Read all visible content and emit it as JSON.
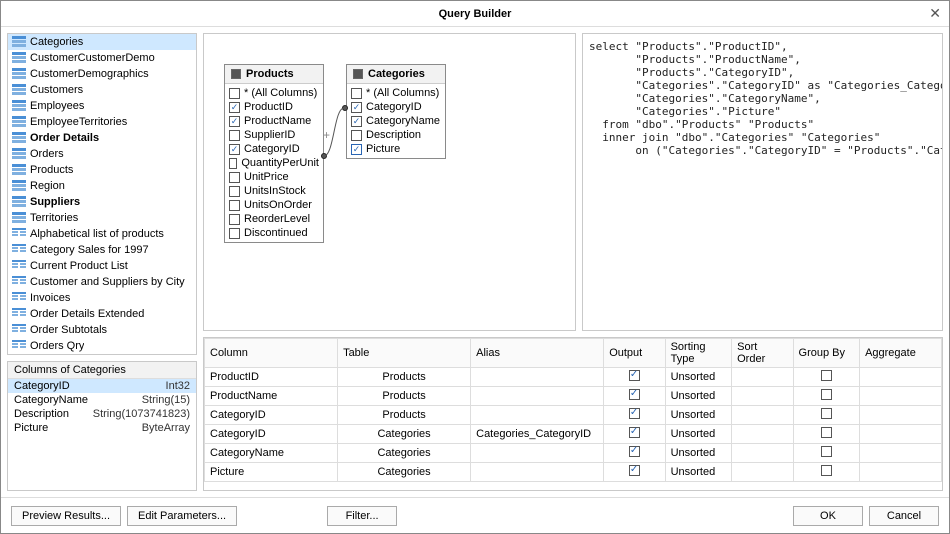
{
  "window": {
    "title": "Query Builder"
  },
  "tables": [
    {
      "name": "Categories",
      "icon": "table",
      "selected": true
    },
    {
      "name": "CustomerCustomerDemo",
      "icon": "table"
    },
    {
      "name": "CustomerDemographics",
      "icon": "table"
    },
    {
      "name": "Customers",
      "icon": "table"
    },
    {
      "name": "Employees",
      "icon": "table"
    },
    {
      "name": "EmployeeTerritories",
      "icon": "table"
    },
    {
      "name": "Order Details",
      "icon": "table",
      "bold": true
    },
    {
      "name": "Orders",
      "icon": "table"
    },
    {
      "name": "Products",
      "icon": "table"
    },
    {
      "name": "Region",
      "icon": "table"
    },
    {
      "name": "Suppliers",
      "icon": "table",
      "bold": true
    },
    {
      "name": "Territories",
      "icon": "table"
    },
    {
      "name": "Alphabetical list of products",
      "icon": "view"
    },
    {
      "name": "Category Sales for 1997",
      "icon": "view"
    },
    {
      "name": "Current Product List",
      "icon": "view"
    },
    {
      "name": "Customer and Suppliers by City",
      "icon": "view"
    },
    {
      "name": "Invoices",
      "icon": "view"
    },
    {
      "name": "Order Details Extended",
      "icon": "view"
    },
    {
      "name": "Order Subtotals",
      "icon": "view"
    },
    {
      "name": "Orders Qry",
      "icon": "view"
    }
  ],
  "columnsHeader": "Columns of Categories",
  "columns": [
    {
      "name": "CategoryID",
      "type": "Int32",
      "selected": true
    },
    {
      "name": "CategoryName",
      "type": "String(15)"
    },
    {
      "name": "Description",
      "type": "String(1073741823)"
    },
    {
      "name": "Picture",
      "type": "ByteArray"
    }
  ],
  "nodes": {
    "products": {
      "title": "Products",
      "fields": [
        {
          "label": "* (All Columns)",
          "checked": false
        },
        {
          "label": "ProductID",
          "checked": true
        },
        {
          "label": "ProductName",
          "checked": true
        },
        {
          "label": "SupplierID",
          "checked": false,
          "plus": true
        },
        {
          "label": "CategoryID",
          "checked": true,
          "linkOut": true
        },
        {
          "label": "QuantityPerUnit",
          "checked": false
        },
        {
          "label": "UnitPrice",
          "checked": false
        },
        {
          "label": "UnitsInStock",
          "checked": false
        },
        {
          "label": "UnitsOnOrder",
          "checked": false
        },
        {
          "label": "ReorderLevel",
          "checked": false
        },
        {
          "label": "Discontinued",
          "checked": false
        }
      ]
    },
    "categories": {
      "title": "Categories",
      "fields": [
        {
          "label": "* (All Columns)",
          "checked": false
        },
        {
          "label": "CategoryID",
          "checked": true,
          "linkIn": true
        },
        {
          "label": "CategoryName",
          "checked": true
        },
        {
          "label": "Description",
          "checked": false
        },
        {
          "label": "Picture",
          "checked": true,
          "blue": true
        }
      ]
    }
  },
  "sql": "select \"Products\".\"ProductID\",\n       \"Products\".\"ProductName\",\n       \"Products\".\"CategoryID\",\n       \"Categories\".\"CategoryID\" as \"Categories_CategoryID\",\n       \"Categories\".\"CategoryName\",\n       \"Categories\".\"Picture\"\n  from \"dbo\".\"Products\" \"Products\"\n  inner join \"dbo\".\"Categories\" \"Categories\"\n       on (\"Categories\".\"CategoryID\" = \"Products\".\"CategoryID\")",
  "grid": {
    "headers": [
      "Column",
      "Table",
      "Alias",
      "Output",
      "Sorting Type",
      "Sort Order",
      "Group By",
      "Aggregate"
    ],
    "rows": [
      {
        "col": "ProductID",
        "table": "Products",
        "alias": "",
        "output": true,
        "sort": "Unsorted"
      },
      {
        "col": "ProductName",
        "table": "Products",
        "alias": "",
        "output": true,
        "sort": "Unsorted"
      },
      {
        "col": "CategoryID",
        "table": "Products",
        "alias": "",
        "output": true,
        "sort": "Unsorted"
      },
      {
        "col": "CategoryID",
        "table": "Categories",
        "alias": "Categories_CategoryID",
        "output": true,
        "sort": "Unsorted"
      },
      {
        "col": "CategoryName",
        "table": "Categories",
        "alias": "",
        "output": true,
        "sort": "Unsorted"
      },
      {
        "col": "Picture",
        "table": "Categories",
        "alias": "",
        "output": true,
        "sort": "Unsorted"
      }
    ]
  },
  "buttons": {
    "preview": "Preview Results...",
    "editParams": "Edit Parameters...",
    "filter": "Filter...",
    "ok": "OK",
    "cancel": "Cancel"
  }
}
